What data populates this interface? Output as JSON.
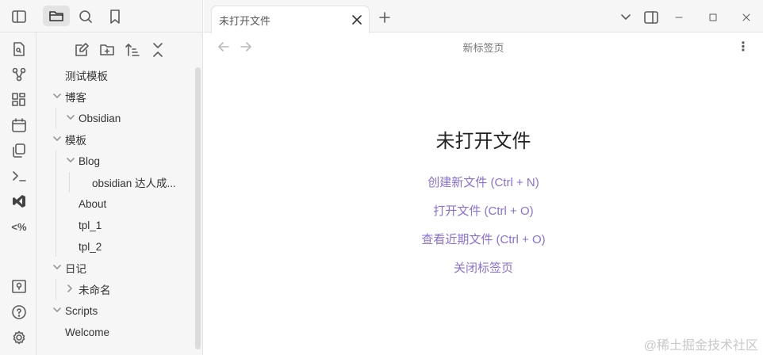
{
  "sidebar_tabs": [
    "sidebar-toggle-icon",
    "folder-icon",
    "search-icon",
    "bookmark-icon"
  ],
  "ribbon": [
    "quick-switcher-icon",
    "graph-icon",
    "canvas-icon",
    "calendar-icon",
    "copy-icon",
    "terminal-icon",
    "vscode-icon",
    "templater-icon"
  ],
  "ribbon_bottom": [
    "vault-icon",
    "help-icon",
    "settings-icon"
  ],
  "tree": [
    {
      "label": "测试模板",
      "level": 0,
      "chevron": ""
    },
    {
      "label": "博客",
      "level": 0,
      "chevron": "down"
    },
    {
      "label": "Obsidian",
      "level": 1,
      "chevron": "down"
    },
    {
      "label": "模板",
      "level": 0,
      "chevron": "down"
    },
    {
      "label": "Blog",
      "level": 1,
      "chevron": "down"
    },
    {
      "label": "obsidian 达人成...",
      "level": 2,
      "chevron": ""
    },
    {
      "label": "About",
      "level": 1,
      "chevron": ""
    },
    {
      "label": "tpl_1",
      "level": 1,
      "chevron": ""
    },
    {
      "label": "tpl_2",
      "level": 1,
      "chevron": ""
    },
    {
      "label": "日记",
      "level": 0,
      "chevron": "down"
    },
    {
      "label": "未命名",
      "level": 1,
      "chevron": "right"
    },
    {
      "label": "Scripts",
      "level": 0,
      "chevron": "down"
    },
    {
      "label": "Welcome",
      "level": 0,
      "chevron": ""
    }
  ],
  "tab": {
    "title": "未打开文件"
  },
  "header": {
    "title": "新标签页"
  },
  "empty": {
    "title": "未打开文件",
    "actions": [
      "创建新文件 (Ctrl + N)",
      "打开文件 (Ctrl + O)",
      "查看近期文件 (Ctrl + O)",
      "关闭标签页"
    ]
  },
  "watermark": "@稀土掘金技术社区",
  "accent": "#8a6fdc"
}
